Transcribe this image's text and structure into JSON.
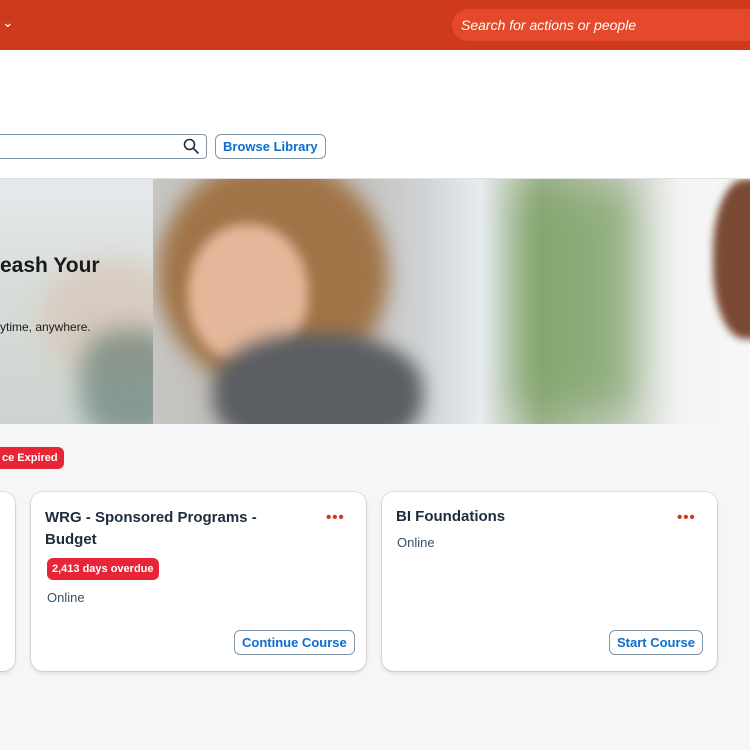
{
  "header": {
    "search_placeholder": "Search for actions or people"
  },
  "toolbar": {
    "browse_label": "Browse Library"
  },
  "banner": {
    "title": "eash Your",
    "subtitle": "ytime, anywhere."
  },
  "status": {
    "expired_label": "ce Expired"
  },
  "cards": [
    {
      "title_line1": "WRG - Sponsored Programs -",
      "title_line2": "Budget",
      "overdue": "2,413 days overdue",
      "type": "Online",
      "button": "Continue Course",
      "more": "•••"
    },
    {
      "title_line1": "BI Foundations",
      "type": "Online",
      "button": "Start Course",
      "more": "•••"
    }
  ],
  "colors": {
    "shell": "#cf3a1d",
    "accent_blue": "#0a6ed1",
    "overdue_red": "#e82536"
  }
}
